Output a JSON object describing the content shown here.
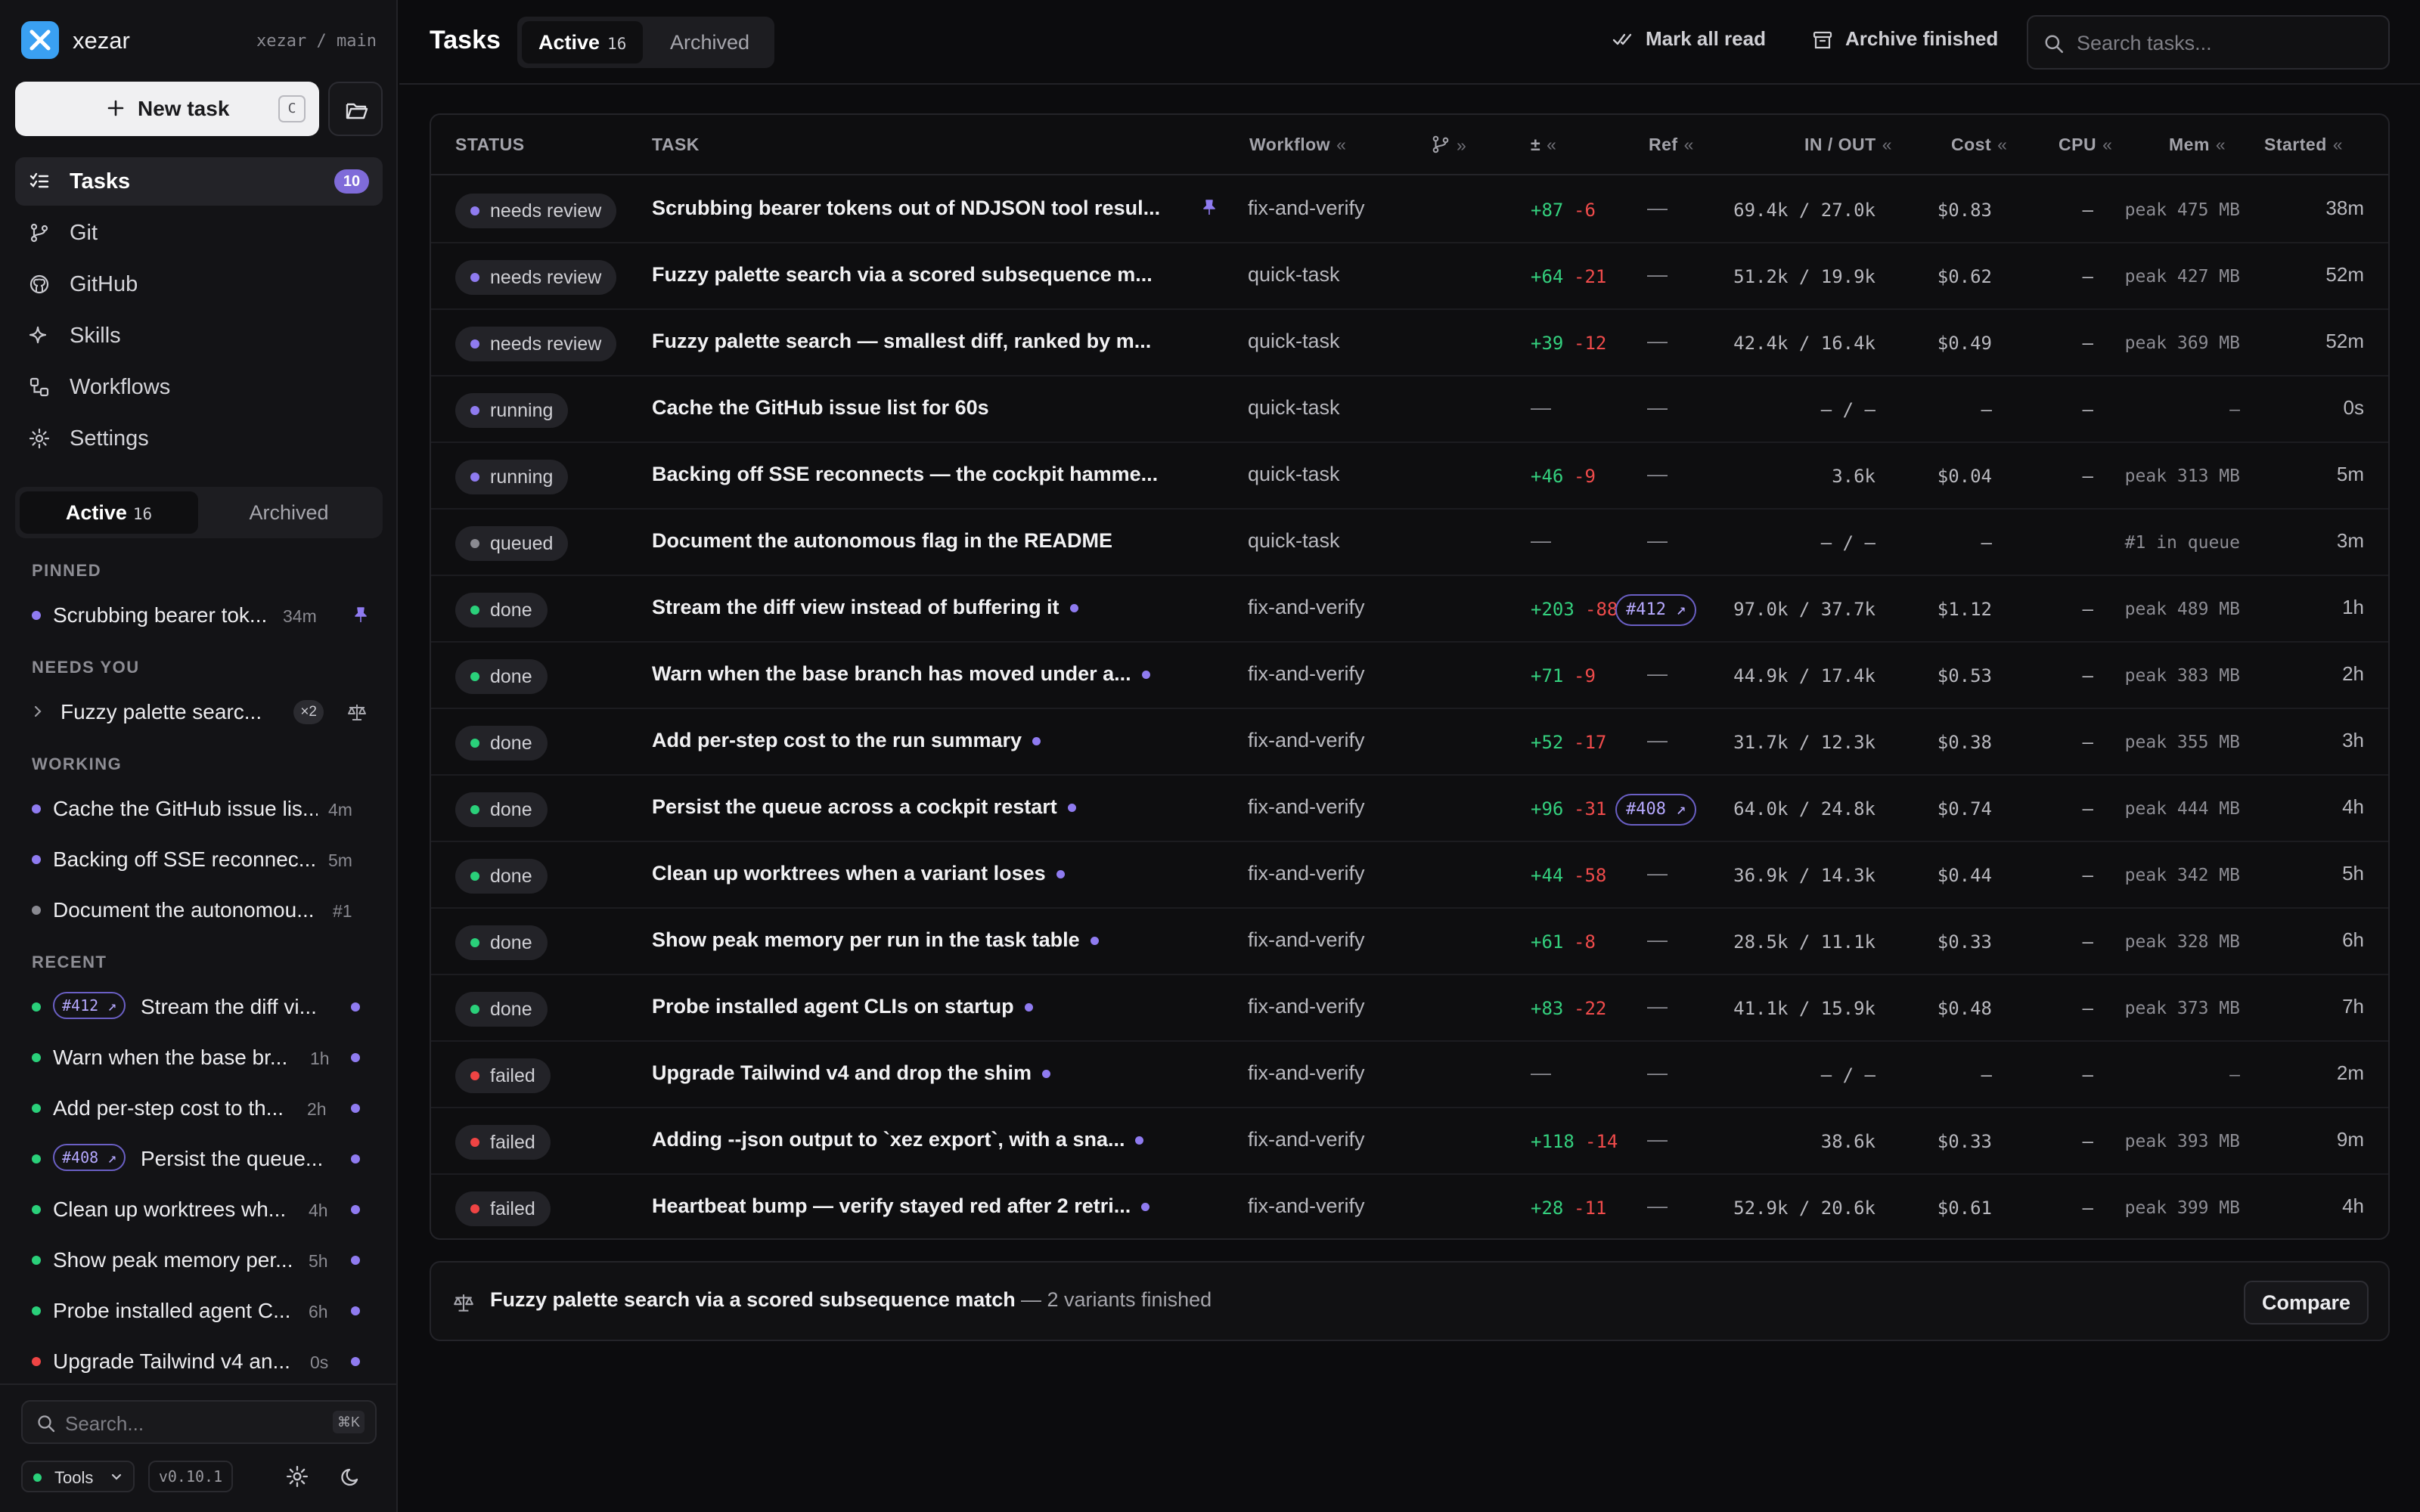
{
  "brand": {
    "name": "xezar",
    "path": "xezar / main"
  },
  "sidebar": {
    "new_task_label": "New task",
    "new_task_shortcut": "C",
    "nav": [
      {
        "label": "Tasks",
        "icon": "tasks-icon",
        "count": "10"
      },
      {
        "label": "Git",
        "icon": "git-branch-icon"
      },
      {
        "label": "GitHub",
        "icon": "github-icon"
      },
      {
        "label": "Skills",
        "icon": "sparkle-icon"
      },
      {
        "label": "Workflows",
        "icon": "workflow-icon"
      },
      {
        "label": "Settings",
        "icon": "gear-icon"
      }
    ],
    "tabs": {
      "active": "Active",
      "active_count": "16",
      "archived": "Archived"
    },
    "sections": {
      "pinned": "PINNED",
      "needs_you": "NEEDS YOU",
      "working": "WORKING",
      "recent": "RECENT"
    },
    "pinned": [
      {
        "title": "Scrubbing bearer tok...",
        "meta": "34m"
      }
    ],
    "needs_you": [
      {
        "title": "Fuzzy palette searc...",
        "variants": "×2"
      }
    ],
    "working": [
      {
        "title": "Cache the GitHub issue lis...",
        "meta": "4m"
      },
      {
        "title": "Backing off SSE reconnec...",
        "meta": "5m"
      },
      {
        "title": "Document the autonomou...",
        "meta": "#1"
      }
    ],
    "recent": [
      {
        "chip": "#412 ↗",
        "title": "Stream the diff vi...",
        "status": "done"
      },
      {
        "title": "Warn when the base br...",
        "meta": "1h",
        "status": "done"
      },
      {
        "title": "Add per-step cost to th...",
        "meta": "2h",
        "status": "done"
      },
      {
        "chip": "#408 ↗",
        "title": "Persist the queue...",
        "status": "done"
      },
      {
        "title": "Clean up worktrees wh...",
        "meta": "4h",
        "status": "done"
      },
      {
        "title": "Show peak memory per...",
        "meta": "5h",
        "status": "done"
      },
      {
        "title": "Probe installed agent C...",
        "meta": "6h",
        "status": "done"
      },
      {
        "title": "Upgrade Tailwind v4 an...",
        "meta": "0s",
        "status": "failed"
      }
    ],
    "search_placeholder": "Search...",
    "search_shortcut": "⌘K",
    "tools_label": "Tools",
    "version": "v0.10.1"
  },
  "header": {
    "title": "Tasks",
    "tab_active": "Active",
    "tab_active_count": "16",
    "tab_archived": "Archived",
    "mark_all_read": "Mark all read",
    "archive_finished": "Archive finished",
    "search_placeholder": "Search tasks..."
  },
  "table": {
    "columns": {
      "status": "STATUS",
      "task": "TASK",
      "workflow": "Workflow",
      "diff": "±",
      "ref": "Ref",
      "inout": "IN / OUT",
      "cost": "Cost",
      "cpu": "CPU",
      "mem": "Mem",
      "started": "Started"
    },
    "rows": [
      {
        "status": "needs review",
        "task": "Scrubbing bearer tokens out of NDJSON tool resul...",
        "pinned": true,
        "unread": false,
        "workflow": "fix-and-verify",
        "add": "+87",
        "del": "-6",
        "ref": "—",
        "inout": "69.4k / 27.0k",
        "cost": "$0.83",
        "cpu": "—",
        "mem": "peak 475 MB",
        "started": "38m"
      },
      {
        "status": "needs review",
        "task": "Fuzzy palette search via a scored subsequence m...",
        "pinned": false,
        "unread": false,
        "workflow": "quick-task",
        "add": "+64",
        "del": "-21",
        "ref": "—",
        "inout": "51.2k / 19.9k",
        "cost": "$0.62",
        "cpu": "—",
        "mem": "peak 427 MB",
        "started": "52m"
      },
      {
        "status": "needs review",
        "task": "Fuzzy palette search — smallest diff, ranked by m...",
        "pinned": false,
        "unread": false,
        "workflow": "quick-task",
        "add": "+39",
        "del": "-12",
        "ref": "—",
        "inout": "42.4k / 16.4k",
        "cost": "$0.49",
        "cpu": "—",
        "mem": "peak 369 MB",
        "started": "52m"
      },
      {
        "status": "running",
        "task": "Cache the GitHub issue list for 60s",
        "pinned": false,
        "unread": false,
        "workflow": "quick-task",
        "add": "",
        "del": "",
        "nodiff": "—",
        "ref": "—",
        "inout": "— / —",
        "cost": "—",
        "cpu": "—",
        "mem": "—",
        "started": "0s"
      },
      {
        "status": "running",
        "task": "Backing off SSE reconnects — the cockpit hamme...",
        "pinned": false,
        "unread": false,
        "workflow": "quick-task",
        "add": "+46",
        "del": "-9",
        "ref": "—",
        "inout": "3.6k",
        "cost": "$0.04",
        "cpu": "—",
        "mem": "peak 313 MB",
        "started": "5m"
      },
      {
        "status": "queued",
        "task": "Document the autonomous flag in the README",
        "pinned": false,
        "unread": false,
        "workflow": "quick-task",
        "add": "",
        "del": "",
        "nodiff": "—",
        "ref": "—",
        "inout": "— / —",
        "cost": "—",
        "cpu": "",
        "mem": "#1 in queue",
        "started": "3m"
      },
      {
        "status": "done",
        "task": "Stream the diff view instead of buffering it",
        "pinned": false,
        "unread": true,
        "workflow": "fix-and-verify",
        "add": "+203",
        "del": "-88",
        "refchip": "#412 ↗",
        "inout": "97.0k / 37.7k",
        "cost": "$1.12",
        "cpu": "—",
        "mem": "peak 489 MB",
        "started": "1h"
      },
      {
        "status": "done",
        "task": "Warn when the base branch has moved under a...",
        "pinned": false,
        "unread": true,
        "workflow": "fix-and-verify",
        "add": "+71",
        "del": "-9",
        "ref": "—",
        "inout": "44.9k / 17.4k",
        "cost": "$0.53",
        "cpu": "—",
        "mem": "peak 383 MB",
        "started": "2h"
      },
      {
        "status": "done",
        "task": "Add per-step cost to the run summary",
        "pinned": false,
        "unread": true,
        "workflow": "fix-and-verify",
        "add": "+52",
        "del": "-17",
        "ref": "—",
        "inout": "31.7k / 12.3k",
        "cost": "$0.38",
        "cpu": "—",
        "mem": "peak 355 MB",
        "started": "3h"
      },
      {
        "status": "done",
        "task": "Persist the queue across a cockpit restart",
        "pinned": false,
        "unread": true,
        "workflow": "fix-and-verify",
        "add": "+96",
        "del": "-31",
        "refchip": "#408 ↗",
        "inout": "64.0k / 24.8k",
        "cost": "$0.74",
        "cpu": "—",
        "mem": "peak 444 MB",
        "started": "4h"
      },
      {
        "status": "done",
        "task": "Clean up worktrees when a variant loses",
        "pinned": false,
        "unread": true,
        "workflow": "fix-and-verify",
        "add": "+44",
        "del": "-58",
        "ref": "—",
        "inout": "36.9k / 14.3k",
        "cost": "$0.44",
        "cpu": "—",
        "mem": "peak 342 MB",
        "started": "5h"
      },
      {
        "status": "done",
        "task": "Show peak memory per run in the task table",
        "pinned": false,
        "unread": true,
        "workflow": "fix-and-verify",
        "add": "+61",
        "del": "-8",
        "ref": "—",
        "inout": "28.5k / 11.1k",
        "cost": "$0.33",
        "cpu": "—",
        "mem": "peak 328 MB",
        "started": "6h"
      },
      {
        "status": "done",
        "task": "Probe installed agent CLIs on startup",
        "pinned": false,
        "unread": true,
        "workflow": "fix-and-verify",
        "add": "+83",
        "del": "-22",
        "ref": "—",
        "inout": "41.1k / 15.9k",
        "cost": "$0.48",
        "cpu": "—",
        "mem": "peak 373 MB",
        "started": "7h"
      },
      {
        "status": "failed",
        "task": "Upgrade Tailwind v4 and drop the shim",
        "pinned": false,
        "unread": true,
        "workflow": "fix-and-verify",
        "add": "",
        "del": "",
        "nodiff": "—",
        "ref": "—",
        "inout": "— / —",
        "cost": "—",
        "cpu": "—",
        "mem": "—",
        "started": "2m"
      },
      {
        "status": "failed",
        "task": "Adding --json output to `xez export`, with a sna...",
        "pinned": false,
        "unread": true,
        "workflow": "fix-and-verify",
        "add": "+118",
        "del": "-14",
        "ref": "—",
        "inout": "38.6k",
        "cost": "$0.33",
        "cpu": "—",
        "mem": "peak 393 MB",
        "started": "9m"
      },
      {
        "status": "failed",
        "task": "Heartbeat bump — verify stayed red after 2 retri...",
        "pinned": false,
        "unread": true,
        "workflow": "fix-and-verify",
        "add": "+28",
        "del": "-11",
        "ref": "—",
        "inout": "52.9k / 20.6k",
        "cost": "$0.61",
        "cpu": "—",
        "mem": "peak 399 MB",
        "started": "4h"
      }
    ]
  },
  "compare": {
    "title": "Fuzzy palette search via a scored subsequence match",
    "suffix": "— 2 variants finished",
    "button": "Compare"
  },
  "colors": {
    "needs_review": "#8f7bf0",
    "running": "#8f7bf0",
    "queued": "#8a8a91",
    "done": "#2ad07a",
    "failed": "#ef4444",
    "accent": "#7f6bd9",
    "logo": "#3aa0f2"
  }
}
